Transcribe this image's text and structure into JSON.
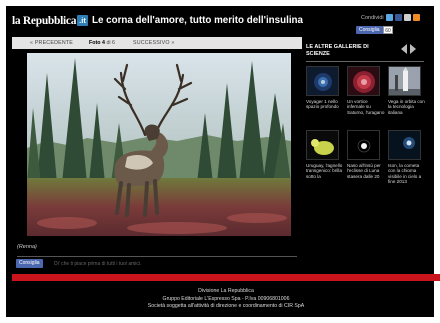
{
  "header": {
    "logo_text": "la Repubblica",
    "logo_badge": ".it",
    "title": "Le corna dell'amore, tutto merito dell'insulina",
    "share_label": "Condividi",
    "share_icons": [
      "twitter-icon",
      "facebook-icon",
      "google-icon",
      "rss-icon"
    ],
    "fb_like_label": "Consiglia",
    "fb_like_count": "60"
  },
  "gallery_nav": {
    "prev_label": "« PRECEDENTE",
    "photo_label": "Foto",
    "current": "4",
    "of_label": "di",
    "total": "6",
    "next_label": "SUCCESSIVO »"
  },
  "photo": {
    "subject": "reindeer",
    "caption": "(Renna)"
  },
  "social_bottom": {
    "fb_label": "Consiglia",
    "fb_text": "Di' che ti piace prima di tutti i tuoi amici."
  },
  "sidebar": {
    "title": "LE ALTRE GALLERIE DI SCIENZE",
    "items": [
      {
        "caption": "Voyager 1 nello spazio profondo",
        "icon": "space-probe-icon"
      },
      {
        "caption": "Un vortice infernale su Saturno, l'uragano",
        "icon": "saturn-vortex-icon"
      },
      {
        "caption": "Vega in orbita con la tecnologia italiana",
        "icon": "rocket-icon"
      },
      {
        "caption": "Uruguay, l'agnello transgenico: brilla sotto la",
        "icon": "glowing-lamb-icon"
      },
      {
        "caption": "Naso all'insù per l'eclisse di Luna stasera dalle 20",
        "icon": "moon-eclipse-icon"
      },
      {
        "caption": "Ison, la cometa con la chioma visibile in cielo a fine 2013",
        "icon": "comet-icon"
      }
    ]
  },
  "footer": {
    "line1": "Divisione La Repubblica",
    "line2": "Gruppo Editoriale L'Espresso Spa - P.Iva 00906801006",
    "line3": "Società soggetta all'attività di direzione e coordinamento di CIR SpA"
  },
  "colors": {
    "background": "#000000",
    "footer_bar": "#c8141a",
    "nav_bar": "#e4e4e4",
    "facebook": "#4a67b0"
  }
}
